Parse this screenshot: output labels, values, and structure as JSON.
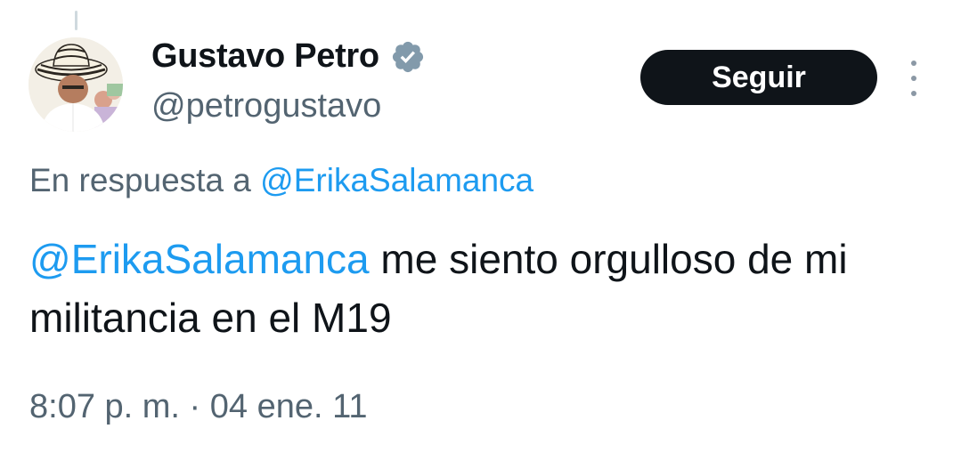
{
  "author": {
    "name": "Gustavo Petro",
    "handle": "@petrogustavo",
    "verified": true
  },
  "follow_button": {
    "label": "Seguir"
  },
  "reply": {
    "prefix": "En respuesta a",
    "mention": "@ErikaSalamanca"
  },
  "tweet": {
    "mention": "@ErikaSalamanca",
    "text": "me siento orgulloso de mi militancia en el M19"
  },
  "timestamp": "8:07 p. m. · 04 ene. 11",
  "colors": {
    "link": "#1d9bf0",
    "secondary_text": "#536471",
    "primary_text": "#0f1419",
    "button_bg": "#0f1419",
    "verified_badge": "#829aab"
  },
  "icons": {
    "verified": "verified-badge-icon",
    "more": "more-options-icon"
  }
}
